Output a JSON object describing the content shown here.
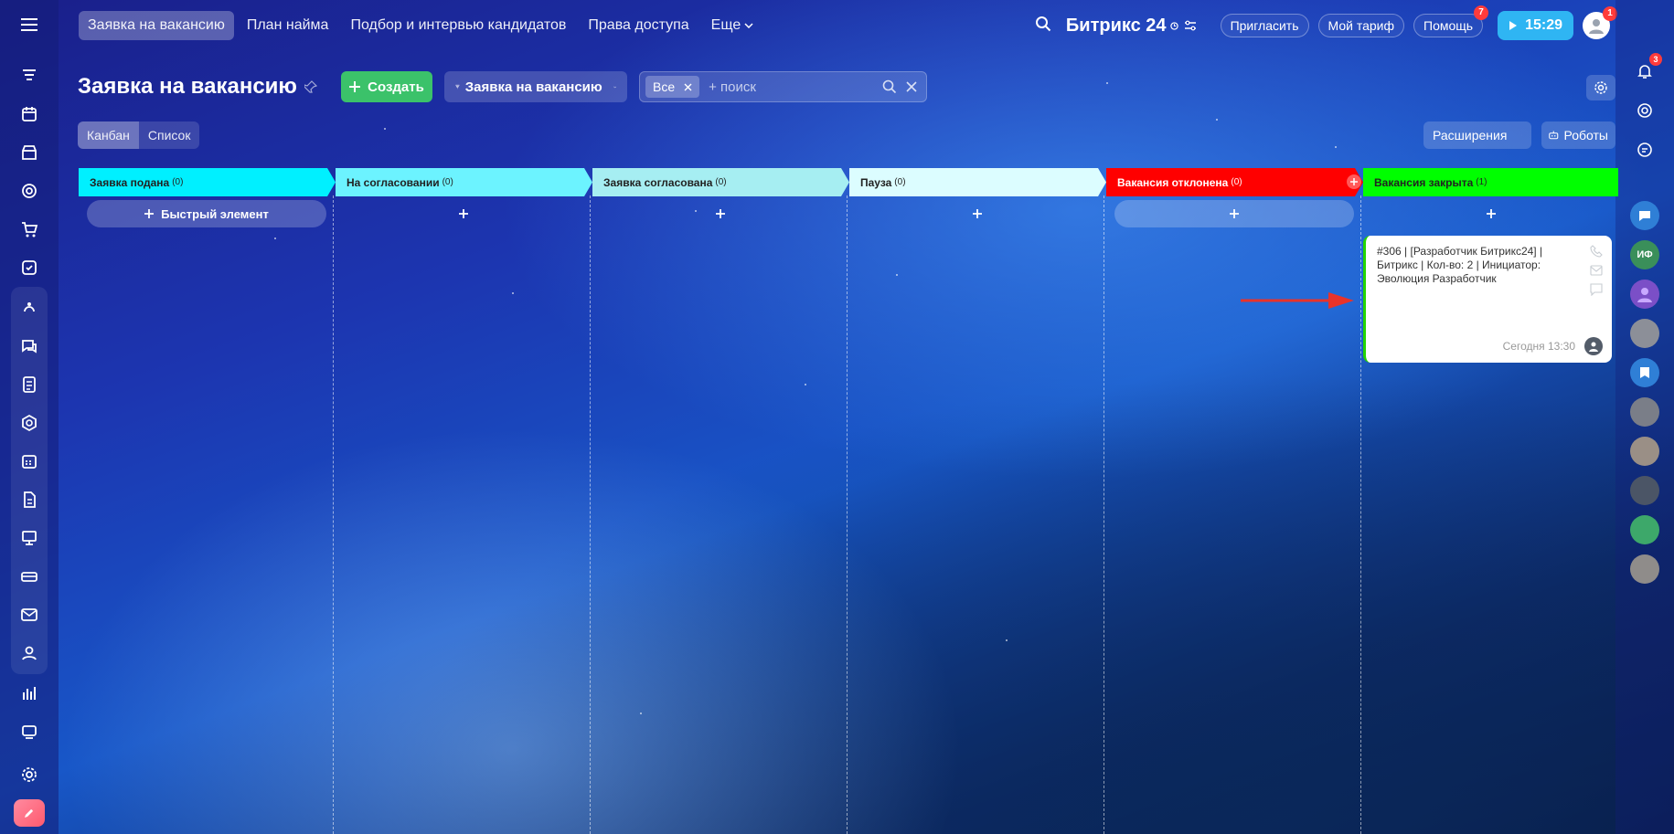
{
  "topnav": {
    "items": [
      {
        "label": "Заявка на вакансию",
        "active": true
      },
      {
        "label": "План найма",
        "active": false
      },
      {
        "label": "Подбор и интервью кандидатов",
        "active": false
      },
      {
        "label": "Права доступа",
        "active": false
      }
    ],
    "more_label": "Еще"
  },
  "header_right": {
    "brand": "Битрикс 24",
    "invite_label": "Пригласить",
    "plan_label": "Мой тариф",
    "help_label": "Помощь",
    "help_badge": "7",
    "time": "15:29",
    "profile_badge": "1"
  },
  "page": {
    "title": "Заявка на вакансию",
    "create_label": "Создать",
    "pipeline_label": "Заявка на вакансию",
    "filter_chip": "Все",
    "search_placeholder": "+ поиск",
    "view_kanban": "Канбан",
    "view_list": "Список",
    "extensions_label": "Расширения",
    "robots_label": "Роботы"
  },
  "columns": [
    {
      "name": "Заявка подана",
      "count": "(0)",
      "color": "#00f0ff",
      "add_label": "Быстрый элемент"
    },
    {
      "name": "На согласовании",
      "count": "(0)",
      "color": "#6cf3ff",
      "add_label": ""
    },
    {
      "name": "Заявка согласована",
      "count": "(0)",
      "color": "#a6eef2",
      "add_label": ""
    },
    {
      "name": "Пауза",
      "count": "(0)",
      "color": "#dcfdff",
      "add_label": ""
    },
    {
      "name": "Вакансия отклонена",
      "count": "(0)",
      "color": "#ff0000",
      "add_label": ""
    },
    {
      "name": "Вакансия закрыта",
      "count": "(1)",
      "color": "#00ff00",
      "add_label": ""
    }
  ],
  "card": {
    "title": "#306 | [Разработчик Битрикс24] | Битрикс | Кол-во: 2 | Инициатор: Эволюция Разработчик",
    "date": "Сегодня 13:30"
  },
  "right_sidebar": {
    "bell_badge": "3",
    "avatar_initials": "ИФ"
  }
}
